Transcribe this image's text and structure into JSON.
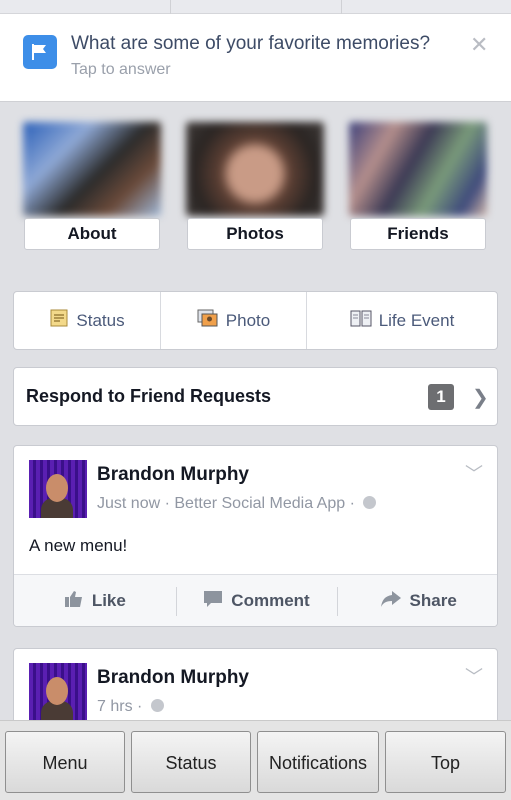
{
  "prompt": {
    "question": "What are some of your favorite memories?",
    "subtitle": "Tap to answer",
    "icon": "flag-icon",
    "close_icon": "close-icon"
  },
  "profile_tiles": [
    {
      "label": "About"
    },
    {
      "label": "Photos"
    },
    {
      "label": "Friends"
    }
  ],
  "composer": {
    "status_label": "Status",
    "photo_label": "Photo",
    "life_event_label": "Life Event"
  },
  "friend_requests": {
    "label": "Respond to Friend Requests",
    "count": "1"
  },
  "posts": [
    {
      "author": "Brandon Murphy",
      "time": "Just now",
      "app": "Better Social Media App",
      "text": "A new menu!",
      "actions": {
        "like": "Like",
        "comment": "Comment",
        "share": "Share"
      }
    },
    {
      "author": "Brandon Murphy",
      "time": "7 hrs"
    }
  ],
  "bottom_bar": {
    "menu": "Menu",
    "status": "Status",
    "notifications": "Notifications",
    "top": "Top"
  },
  "colors": {
    "accent": "#3d8ee8",
    "background": "#dfe0e4"
  }
}
